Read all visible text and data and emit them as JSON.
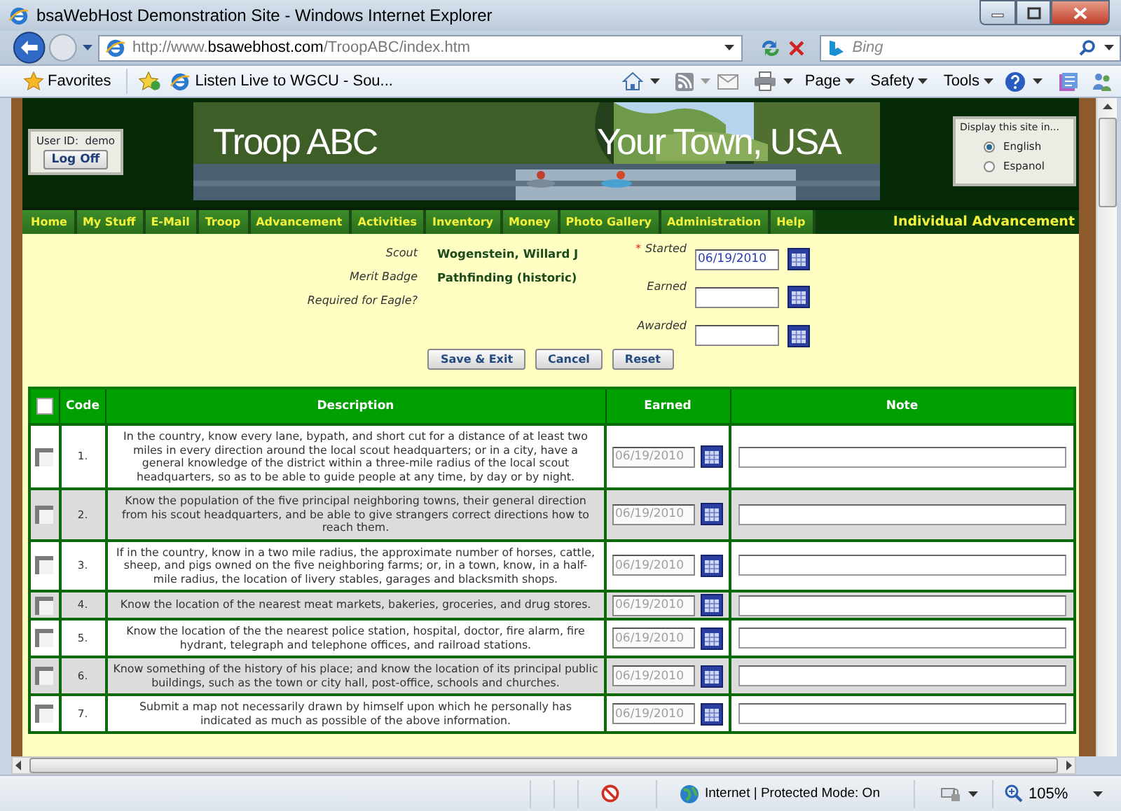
{
  "window": {
    "title": "bsaWebHost Demonstration Site - Windows Internet Explorer"
  },
  "address_bar": {
    "url": "http://www.**bsawebhost.com**/TroopABC/index.htm",
    "search_placeholder": "Bing"
  },
  "favorites_bar": {
    "favorites": "Favorites",
    "link": "Listen Live to WGCU - Sou...",
    "menus": [
      "Page",
      "Safety",
      "Tools"
    ]
  },
  "header": {
    "user_label": "User ID:",
    "user": "demo",
    "logoff": "Log Off",
    "banner_left": "Troop ABC",
    "banner_right": "Your Town, USA",
    "language_title": "Display this site in...",
    "languages": [
      {
        "label": "English",
        "selected": true
      },
      {
        "label": "Espanol",
        "selected": false
      }
    ]
  },
  "nav": {
    "items": [
      "Home",
      "My Stuff",
      "E-Mail",
      "Troop",
      "Advancement",
      "Activities",
      "Inventory",
      "Money",
      "Photo Gallery",
      "Administration",
      "Help"
    ],
    "page_title": "Individual Advancement"
  },
  "form": {
    "fields": [
      {
        "label": "Scout",
        "value": "Wogenstein, Willard J"
      },
      {
        "label": "Merit Badge",
        "value": "Pathfinding (historic)"
      },
      {
        "label": "Required for Eagle?"
      }
    ],
    "dates": [
      {
        "label": "Started",
        "marker": "*",
        "value": "06/19/2010"
      },
      {
        "label": "Earned"
      },
      {
        "label": "Awarded"
      }
    ]
  },
  "buttons": [
    "Save & Exit",
    "Cancel",
    "Reset"
  ],
  "table": {
    "columns": [
      "Code",
      "Description",
      "Earned",
      "Note"
    ],
    "all_checked": false,
    "rows": [
      {
        "checked": false,
        "code": "1.",
        "description": "In the country, know every lane, bypath, and short cut for a distance of at least two miles in every direction around the local scout headquarters; or in a city, have a general knowledge of the district within a three-mile radius of the local scout headquarters, so as to be able to guide people at any time, by day or by night.",
        "earned": "06/19/2010",
        "earned_disabled": true
      },
      {
        "checked": false,
        "code": "2.",
        "description": "Know the population of the five principal neighboring towns, their general direction from his scout headquarters, and be able to give strangers correct directions how to reach them.",
        "earned": "06/19/2010",
        "earned_disabled": true
      },
      {
        "checked": false,
        "code": "3.",
        "description": "If in the country, know in a two mile radius, the approximate number of horses, cattle, sheep, and pigs owned on the five neighboring farms; or, in a town, know, in a half-mile radius, the location of livery stables, garages and blacksmith shops.",
        "earned": "06/19/2010",
        "earned_disabled": true
      },
      {
        "checked": false,
        "code": "4.",
        "description": "Know the location of the nearest meat markets, bakeries, groceries, and drug stores.",
        "earned": "06/19/2010",
        "earned_disabled": true
      },
      {
        "checked": false,
        "code": "5.",
        "description": "Know the location of the the nearest police station, hospital, doctor, fire alarm, fire hydrant, telegraph and telephone offices, and railroad stations.",
        "earned": "06/19/2010",
        "earned_disabled": true
      },
      {
        "checked": false,
        "code": "6.",
        "description": "Know something of the history of his place; and know the location of its principal public buildings, such as the town or city hall, post-office, schools and churches.",
        "earned": "06/19/2010",
        "earned_disabled": true
      },
      {
        "checked": false,
        "code": "7.",
        "description": "Submit a map not necessarily drawn by himself upon which he personally has indicated as much as possible of the above information.",
        "earned": "06/19/2010",
        "earned_disabled": true
      }
    ]
  },
  "status_bar": {
    "zone": "Internet | Protected Mode: On",
    "zoom": "105%"
  }
}
